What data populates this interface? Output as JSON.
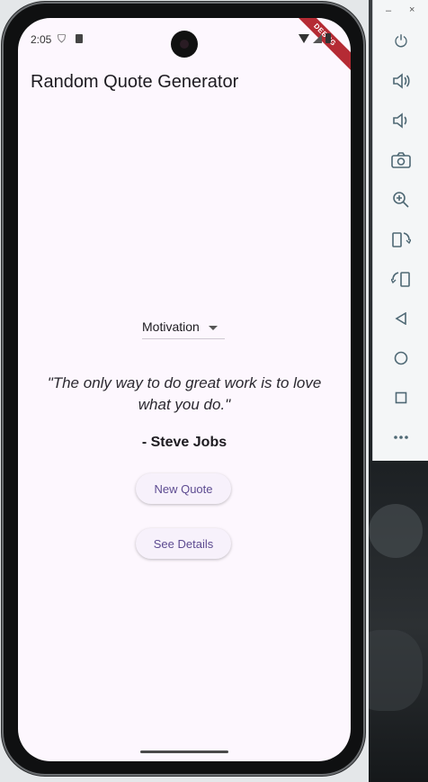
{
  "status_bar": {
    "time": "2:05",
    "debug_label": "DEBUG"
  },
  "app": {
    "title": "Random Quote Generator"
  },
  "category_dropdown": {
    "selected": "Motivation"
  },
  "quote": {
    "text": "\"The only way to do great work is to love what you do.\"",
    "author": "- Steve Jobs"
  },
  "buttons": {
    "new_quote": "New Quote",
    "see_details": "See Details"
  },
  "emulator_toolbar": {
    "minimize": "–",
    "close": "×",
    "items": [
      {
        "name": "power-icon",
        "glyph": "⏻"
      },
      {
        "name": "volume-up-icon",
        "glyph": "🔊"
      },
      {
        "name": "volume-down-icon",
        "glyph": "🔉"
      },
      {
        "name": "camera-icon",
        "glyph": "📷"
      },
      {
        "name": "zoom-icon",
        "glyph": "🔍"
      },
      {
        "name": "rotate-left-icon",
        "glyph": "⟲"
      },
      {
        "name": "rotate-right-icon",
        "glyph": "⟳"
      },
      {
        "name": "back-icon",
        "glyph": "◁"
      },
      {
        "name": "home-icon",
        "glyph": "○"
      },
      {
        "name": "overview-icon",
        "glyph": "□"
      },
      {
        "name": "more-icon",
        "glyph": "•••"
      }
    ]
  },
  "colors": {
    "screen_bg": "#fdf7fe",
    "button_text": "#5d4b91",
    "debug_ribbon": "#b52b34"
  }
}
